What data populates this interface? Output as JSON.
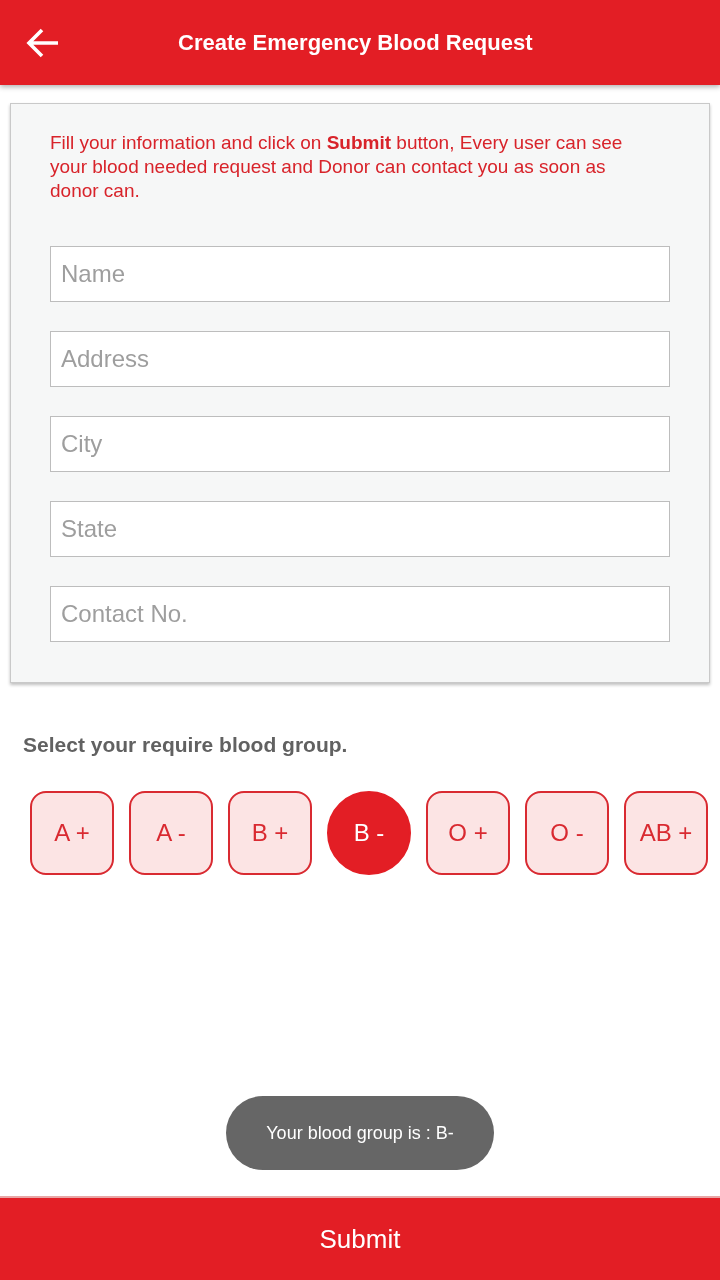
{
  "app_bar": {
    "title": "Create Emergency Blood Request"
  },
  "form": {
    "intro": "Fill your information and click on **Submit** button, Every user can see your blood needed request and Donor can contact you as soon as donor can.",
    "fields": [
      {
        "placeholder": "Name"
      },
      {
        "placeholder": "Address"
      },
      {
        "placeholder": "City"
      },
      {
        "placeholder": "State"
      },
      {
        "placeholder": "Contact No."
      }
    ]
  },
  "blood_group": {
    "label": "Select your require blood group.",
    "options": [
      {
        "label": "A +",
        "selected": false
      },
      {
        "label": "A -",
        "selected": false
      },
      {
        "label": "B +",
        "selected": false
      },
      {
        "label": "B -",
        "selected": true
      },
      {
        "label": "O +",
        "selected": false
      },
      {
        "label": "O -",
        "selected": false
      },
      {
        "label": "AB +",
        "selected": false
      }
    ]
  },
  "toast": {
    "text": "Your blood group is : B-"
  },
  "submit_button": {
    "label": "Submit"
  }
}
